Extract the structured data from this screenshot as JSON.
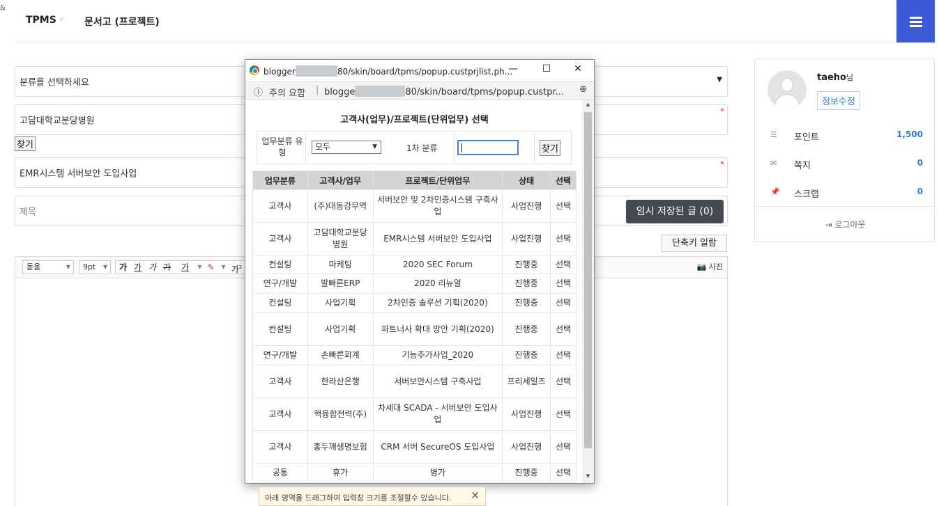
{
  "header": {
    "brand": "TPMS",
    "brand_caret": "∨",
    "page_title": "문서고 (프로젝트)",
    "corner_glyph": "&"
  },
  "form": {
    "category_select": "분류를 선택하세요",
    "customer_value": "고담대학교분당병원",
    "find_label": "찾기",
    "project_value": "EMR시스템 서버보안 도입사업",
    "title_placeholder": "제목",
    "required_mark": "*",
    "temp_saved_label": "임시 저장된 글 (0)",
    "shortcut_label": "단축키 일람"
  },
  "editor": {
    "font_name": "돋움",
    "font_size": "9pt",
    "bold": "가",
    "underline": "가",
    "italic": "가",
    "strike": "가",
    "font_color": "가",
    "superscript": "가",
    "photo_label": "사진",
    "resize_tip": "아래 영역을 드래그하여 입력창 크기를 조절할수 있습니다.",
    "resize_tip_close": "✕"
  },
  "sidebar": {
    "user": "taeho",
    "user_suffix": "님",
    "edit_label": "정보수정",
    "rows": [
      {
        "label": "포인트",
        "value": "1,500",
        "icon": "database-icon"
      },
      {
        "label": "쪽지",
        "value": "0",
        "icon": "envelope-icon"
      },
      {
        "label": "스크랩",
        "value": "0",
        "icon": "pin-icon"
      }
    ],
    "logout": "로그아웃"
  },
  "popup": {
    "window_title_prefix": "blogger",
    "window_title_suffix": "80/skin/board/tpms/popup.custprjlist.ph...",
    "warning_label": "주의 요함",
    "addr_prefix": "blogge",
    "addr_suffix": "80/skin/board/tpms/popup.custpr...",
    "heading": "고객사(업무)/프로젝트(단위업무) 선택",
    "filter_label": "업무분류 유형",
    "filter_value": "모두",
    "level1_label": "1차 분류",
    "find_label": "찾기",
    "columns": [
      "업무분류",
      "고객사/업무",
      "프로젝트/단위업무",
      "상태",
      "선택"
    ],
    "rows": [
      [
        "고객사",
        "(주)대동강무역",
        "서버보안 및 2차인증시스템 구축사업",
        "사업진행",
        "선택"
      ],
      [
        "고객사",
        "고담대학교분당병원",
        "EMR시스템 서버보안 도입사업",
        "사업진행",
        "선택"
      ],
      [
        "컨설팅",
        "마케팅",
        "2020 SEC Forum",
        "진행중",
        "선택"
      ],
      [
        "연구/개발",
        "발빠른ERP",
        "2020 리뉴얼",
        "진행중",
        "선택"
      ],
      [
        "컨설팅",
        "사업기획",
        "2차인증 솔루션 기획(2020)",
        "진행중",
        "선택"
      ],
      [
        "컨설팅",
        "사업기획",
        "파트너사 확대 방안 기획(2020)",
        "진행중",
        "선택"
      ],
      [
        "연구/개발",
        "손빠른회계",
        "기능추가사업_2020",
        "진행중",
        "선택"
      ],
      [
        "고객사",
        "한라산은행",
        "서버보안시스템 구축사업",
        "프리세일즈",
        "선택"
      ],
      [
        "고객사",
        "핵융합전력(주)",
        "차세대 SCADA - 서버보안 도입사업",
        "사업진행",
        "선택"
      ],
      [
        "고객사",
        "홍두깨생명보험",
        "CRM 서버 SecureOS 도입사업",
        "사업진행",
        "선택"
      ],
      [
        "공통",
        "휴가",
        "병가",
        "진행중",
        "선택"
      ]
    ]
  },
  "colors": {
    "accent": "#3b5bdb",
    "link": "#2c7bd6",
    "dark_button": "#454a52",
    "required": "#ee3333"
  }
}
